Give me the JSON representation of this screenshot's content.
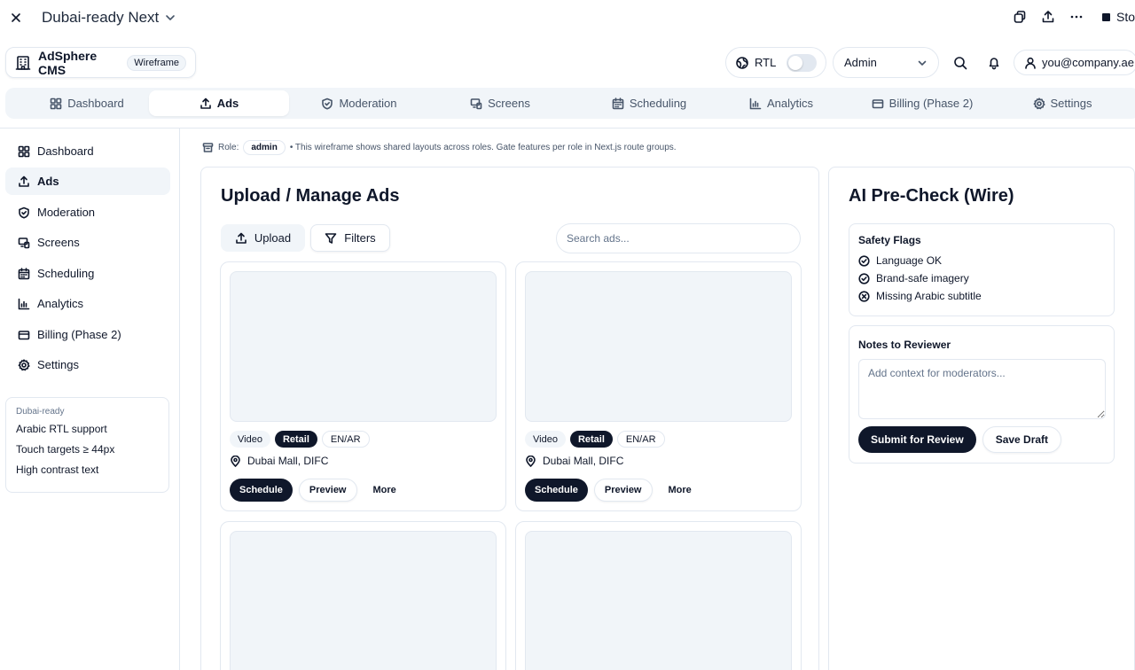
{
  "window": {
    "title": "Dubai-ready Next",
    "stop_label": "Sto"
  },
  "header": {
    "brand_name": "AdSphere CMS",
    "brand_badge": "Wireframe",
    "rtl_label": "RTL",
    "rtl_enabled": false,
    "role_selected": "Admin",
    "user_email": "you@company.ae"
  },
  "tabs": [
    {
      "label": "Dashboard",
      "icon": "grid-icon"
    },
    {
      "label": "Ads",
      "icon": "upload-icon",
      "active": true
    },
    {
      "label": "Moderation",
      "icon": "shield-check-icon"
    },
    {
      "label": "Screens",
      "icon": "screens-icon"
    },
    {
      "label": "Scheduling",
      "icon": "calendar-icon"
    },
    {
      "label": "Analytics",
      "icon": "bar-chart-icon"
    },
    {
      "label": "Billing (Phase 2)",
      "icon": "credit-card-icon"
    },
    {
      "label": "Settings",
      "icon": "gear-icon"
    }
  ],
  "sidebar": {
    "items": [
      {
        "label": "Dashboard",
        "icon": "grid-icon"
      },
      {
        "label": "Ads",
        "icon": "upload-icon",
        "active": true
      },
      {
        "label": "Moderation",
        "icon": "shield-check-icon"
      },
      {
        "label": "Screens",
        "icon": "screens-icon"
      },
      {
        "label": "Scheduling",
        "icon": "calendar-icon"
      },
      {
        "label": "Analytics",
        "icon": "bar-chart-icon"
      },
      {
        "label": "Billing (Phase 2)",
        "icon": "credit-card-icon"
      },
      {
        "label": "Settings",
        "icon": "gear-icon"
      }
    ],
    "card": {
      "caption": "Dubai-ready",
      "lines": [
        "Arabic RTL support",
        "Touch targets ≥ 44px",
        "High contrast text"
      ]
    }
  },
  "role_bar": {
    "prefix": "Role:",
    "role": "admin",
    "note": "• This wireframe shows shared layouts across roles. Gate features per role in Next.js route groups."
  },
  "main": {
    "title": "Upload / Manage Ads",
    "upload_label": "Upload",
    "filters_label": "Filters",
    "search_placeholder": "Search ads...",
    "ads": [
      {
        "chips": [
          "Video",
          "Retail",
          "EN/AR"
        ],
        "location": "Dubai Mall, DIFC",
        "actions": [
          "Schedule",
          "Preview",
          "More"
        ]
      },
      {
        "chips": [
          "Video",
          "Retail",
          "EN/AR"
        ],
        "location": "Dubai Mall, DIFC",
        "actions": [
          "Schedule",
          "Preview",
          "More"
        ]
      }
    ]
  },
  "precheck": {
    "title": "AI Pre-Check (Wire)",
    "flags_title": "Safety Flags",
    "flags": [
      {
        "label": "Language OK",
        "status": "ok"
      },
      {
        "label": "Brand-safe imagery",
        "status": "ok"
      },
      {
        "label": "Missing Arabic subtitle",
        "status": "fail"
      }
    ],
    "notes_title": "Notes to Reviewer",
    "notes_placeholder": "Add context for moderators...",
    "submit_label": "Submit for Review",
    "save_label": "Save Draft"
  }
}
